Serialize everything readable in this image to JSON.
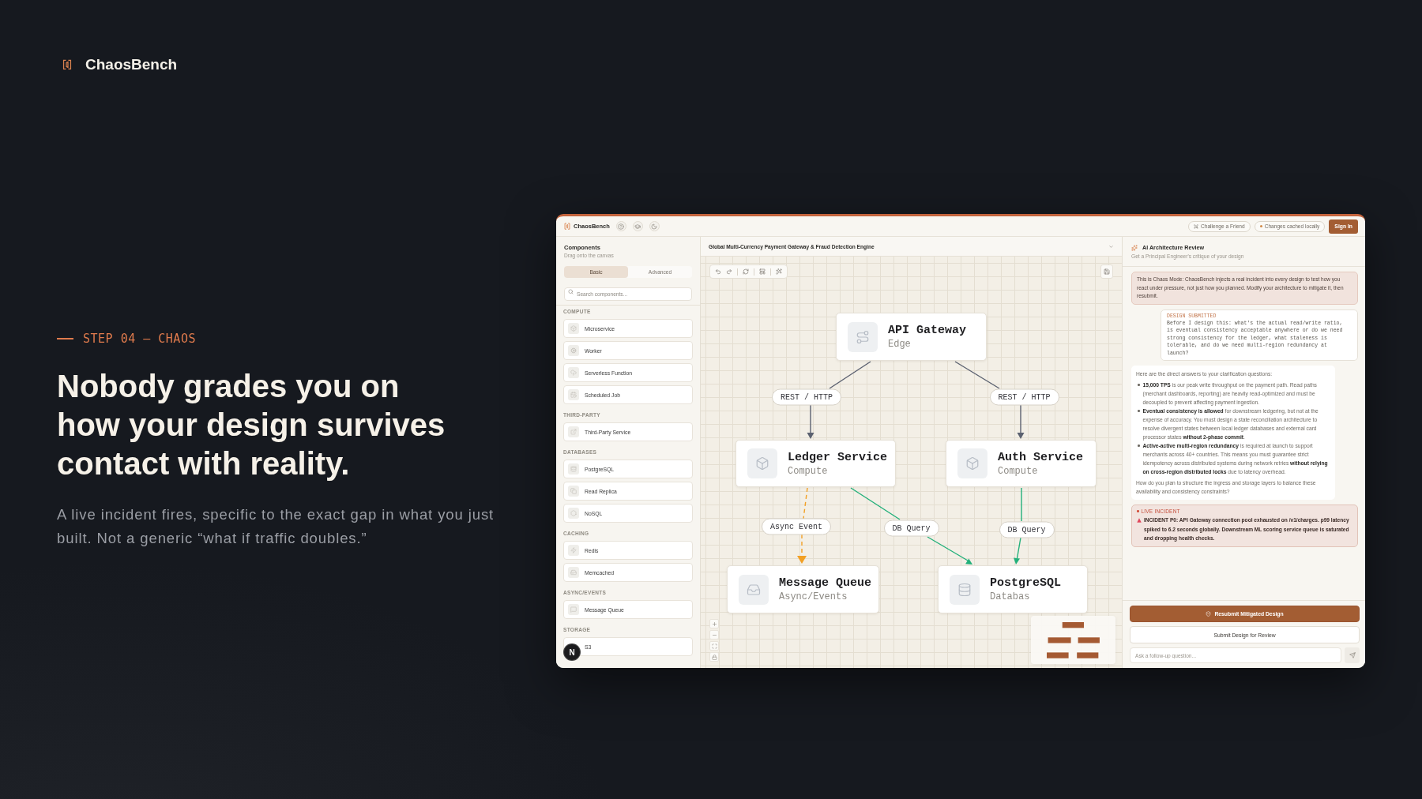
{
  "brand": {
    "name": "ChaosBench"
  },
  "hero": {
    "step": "STEP 04 — CHAOS",
    "headline": "Nobody grades you on how your design survives contact with reality.",
    "description": "A live incident fires, specific to the exact gap in what you just built. Not a generic “what if traffic doubles.”"
  },
  "app": {
    "topbar": {
      "brand": "ChaosBench",
      "actions": [
        {
          "kind": "invite",
          "label": "Challenge a Friend"
        },
        {
          "kind": "status",
          "label": "Changes cached locally"
        },
        {
          "kind": "primary",
          "label": "Sign In"
        }
      ]
    },
    "sidebar": {
      "title": "Components",
      "subtitle": "Drag onto the canvas",
      "tabs": [
        {
          "label": "Basic",
          "selected": true
        },
        {
          "label": "Advanced",
          "selected": false
        }
      ],
      "search": {
        "placeholder": "Search components..."
      },
      "sections": [
        {
          "title": "COMPUTE",
          "items": [
            "Microservice",
            "Worker",
            "Serverless Function",
            "Scheduled Job"
          ]
        },
        {
          "title": "THIRD-PARTY",
          "items": [
            "Third-Party Service"
          ]
        },
        {
          "title": "DATABASES",
          "items": [
            "PostgreSQL",
            "Read Replica",
            "NoSQL"
          ]
        },
        {
          "title": "CACHING",
          "items": [
            "Redis",
            "Memcached"
          ]
        },
        {
          "title": "ASYNC/EVENTS",
          "items": [
            "Message Queue"
          ]
        },
        {
          "title": "STORAGE",
          "items": [
            "S3"
          ]
        }
      ]
    },
    "canvas": {
      "title": "Global Multi-Currency Payment Gateway & Fraud Detection Engine",
      "nodes": [
        {
          "title": "API Gateway",
          "subtitle": "Edge"
        },
        {
          "title": "Ledger Service",
          "subtitle": "Compute"
        },
        {
          "title": "Auth Service",
          "subtitle": "Compute"
        },
        {
          "title": "Message Queue",
          "subtitle": "Async/Events"
        },
        {
          "title": "PostgreSQL",
          "subtitle": "Databas"
        }
      ],
      "edges": [
        {
          "label": "REST / HTTP",
          "kind": "request"
        },
        {
          "label": "REST / HTTP",
          "kind": "request"
        },
        {
          "label": "Async Event",
          "kind": "event"
        },
        {
          "label": "DB Query",
          "kind": "query"
        },
        {
          "label": "DB Query",
          "kind": "query"
        }
      ]
    },
    "review": {
      "title": "AI Architecture Review",
      "subtitle": "Get a Principal Engineer's critique of your design",
      "messages": [
        {
          "kind": "notice",
          "text": "This is Chaos Mode: ChaosBench injects a real incident into every design to test how you react under pressure, not just how you planned. Modify your architecture to mitigate it, then resubmit."
        },
        {
          "kind": "user",
          "label": "DESIGN SUBMITTED",
          "text": "Before I design this: what's the actual read/write ratio, is eventual consistency acceptable anywhere or do we need strong consistency for the ledger, what staleness is tolerable, and do we need multi-region redundancy at launch?"
        },
        {
          "kind": "assistant",
          "intro": "Here are the direct answers to your clarification questions:",
          "points": [
            "**15,000 TPS** is our peak write throughput on the payment path. Read paths (merchant dashboards, reporting) are heavily read-optimized and must be decoupled to prevent affecting payment ingestion.",
            "**Eventual consistency is allowed** for downstream ledgering, but not at the expense of accuracy. You must design a state reconciliation architecture to resolve divergent states between local ledger databases and external card processor states **without 2-phase commit**.",
            "**Active-active multi-region redundancy** is required at launch to support merchants across 40+ countries. This means you must guarantee strict idempotency across distributed systems during network retries **without relying on cross-region distributed locks** due to latency overhead."
          ],
          "outro": "How do you plan to structure the ingress and storage layers to balance these availability and consistency constraints?"
        },
        {
          "kind": "incident",
          "label": "LIVE INCIDENT",
          "text": "INCIDENT P0: API Gateway connection pool exhausted on /v1/charges. p99 latency spiked to 6.2 seconds globally. Downstream ML scoring service queue is saturated and dropping health checks."
        }
      ],
      "actions": [
        {
          "kind": "primary",
          "label": "Resubmit Mitigated Design"
        },
        {
          "kind": "secondary",
          "label": "Submit Design for Review"
        }
      ],
      "input": {
        "placeholder": "Ask a follow-up question..."
      }
    }
  },
  "dev_badge": {
    "label": "N"
  }
}
